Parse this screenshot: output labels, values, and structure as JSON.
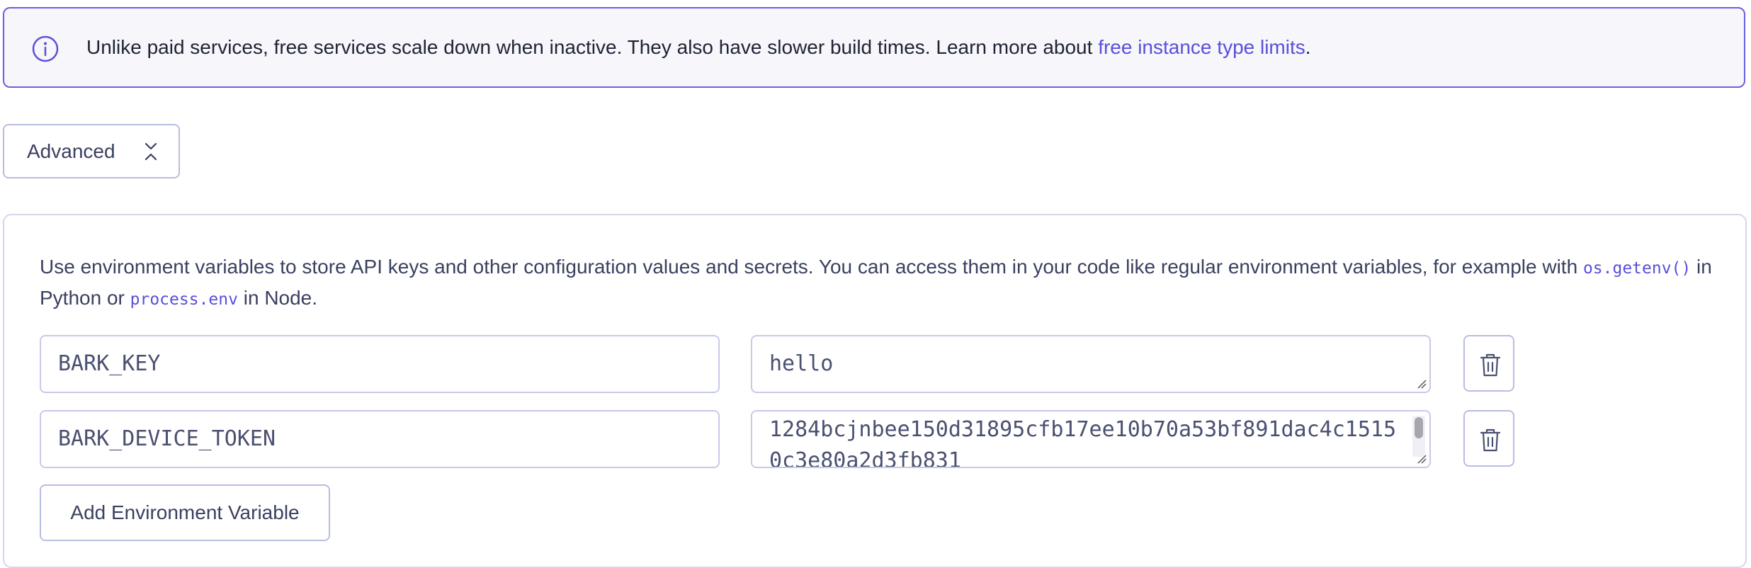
{
  "banner": {
    "icon": "info-icon",
    "message": "Unlike paid services, free services scale down when inactive. They also have slower build times. Learn more about ",
    "link_text": "free instance type limits",
    "suffix": "."
  },
  "advanced": {
    "label": "Advanced",
    "icon": "chevrons-collapse-icon"
  },
  "env": {
    "description_part1": "Use environment variables to store API keys and other configuration values and secrets. You can access them in your code like regular environment variables, for example with ",
    "code1": "os.getenv()",
    "description_part2": " in Python or ",
    "code2": "process.env",
    "description_part3": " in Node.",
    "variables": [
      {
        "key": "BARK_KEY",
        "value": "hello"
      },
      {
        "key": "BARK_DEVICE_TOKEN",
        "value": "1284bcjnbee150d31895cfb17ee10b70a53bf891dac4c15150c3e80a2d3fb831"
      }
    ],
    "delete_icon": "trash-icon",
    "add_label": "Add Environment Variable"
  },
  "colors": {
    "accent": "#5a4fdb",
    "banner_border": "#6a5fe0",
    "banner_bg": "#f6f6fb",
    "field_border": "#c6cae8"
  }
}
